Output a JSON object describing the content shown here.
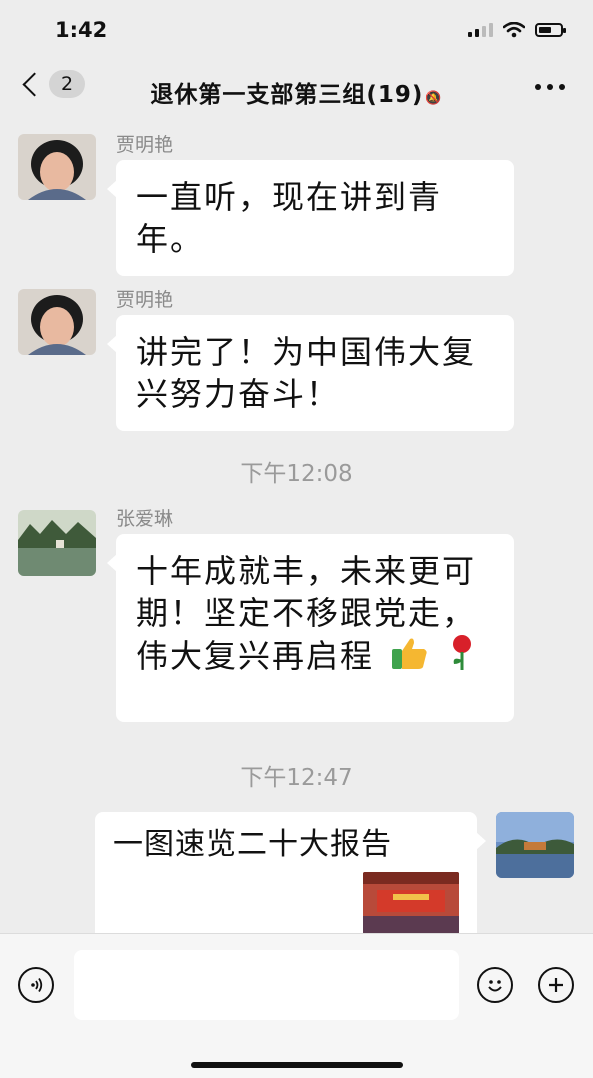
{
  "status_bar": {
    "time": "1:42"
  },
  "nav": {
    "back_count": "2",
    "title": "退休第一支部第三组(19)",
    "mute_icon": "mute-bell-icon"
  },
  "messages": [
    {
      "sender": "贾明艳",
      "text": "一直听，现在讲到青年。"
    },
    {
      "sender": "贾明艳",
      "text": "讲完了！为中国伟大复兴努力奋斗！"
    },
    {
      "timestamp": "下午12:08"
    },
    {
      "sender": "张爱琳",
      "text": "十年成就丰，未来更可期！坚定不移跟党走，伟大复兴再启程",
      "emojis": [
        "thumbs-up",
        "rose"
      ]
    },
    {
      "timestamp": "下午12:47"
    },
    {
      "self": true,
      "text": "一图速览二十大报告"
    }
  ],
  "colors": {
    "background": "#ededed",
    "bubble": "#ffffff",
    "timestamp": "#9a9a9a",
    "sender": "#8a8a8a"
  }
}
